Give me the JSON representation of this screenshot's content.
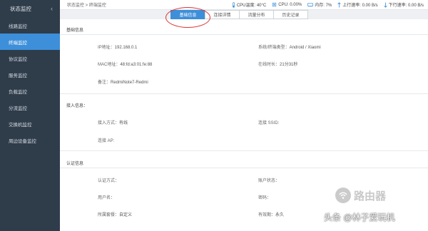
{
  "sidebar": {
    "title": "状态监控",
    "items": [
      {
        "label": "线路监控"
      },
      {
        "label": "终端监控"
      },
      {
        "label": "协议监控"
      },
      {
        "label": "服务监控"
      },
      {
        "label": "负载监控"
      },
      {
        "label": "分流监控"
      },
      {
        "label": "交换机监控"
      },
      {
        "label": "周边设备监控"
      }
    ]
  },
  "topbar": {
    "breadcrumb": "状态监控 > 终端监控",
    "cpu_temp": "CPU温度: 40°C",
    "cpu": "CPU: 0.00%",
    "mem": "内存: 7%",
    "up": "上行速率: 0.00 B/s",
    "down": "下行速率: 0.00 B/s"
  },
  "tabs": [
    {
      "label": "基础信息",
      "active": true
    },
    {
      "label": "连接详情",
      "active": false
    },
    {
      "label": "流量分布",
      "active": false
    },
    {
      "label": "历史记录",
      "active": false
    }
  ],
  "basic": {
    "title": "基础信息",
    "ip_label": "IP地址：",
    "ip_value": "192.168.0.1",
    "os_label": "系统/终端类型：",
    "os_value": "Android / Xiaomi",
    "mac_label": "MAC地址：",
    "mac_value": "48:fd:a3:01:fe:88",
    "online_label": "在线时长：",
    "online_value": "21分31秒",
    "note_label": "备注：",
    "note_value": "RedmiNote7-Redmi"
  },
  "access": {
    "title": "接入信息：",
    "mode_label": "接入方式：",
    "mode_value": "有线",
    "ssid_label": "连接 SSID:",
    "ssid_value": "",
    "ap_label": "连接 AP:",
    "ap_value": ""
  },
  "auth": {
    "title": "认证信息",
    "method_label": "认证方式：",
    "method_value": "",
    "status_label": "账户状态：",
    "status_value": "",
    "user_label": "用户名：",
    "user_value": "",
    "pwd_label": "密码：",
    "pwd_value": "",
    "plan_label": "所属套餐：",
    "plan_value": "自定义",
    "valid_label": "有效期：",
    "valid_value": "永久"
  },
  "watermark": {
    "router": "路由器",
    "author": "头条 @林子爱玩机"
  },
  "colors": {
    "sidebar_bg": "#2f3c4a",
    "accent": "#3d8fd9",
    "highlight_circle": "#dd3333"
  }
}
